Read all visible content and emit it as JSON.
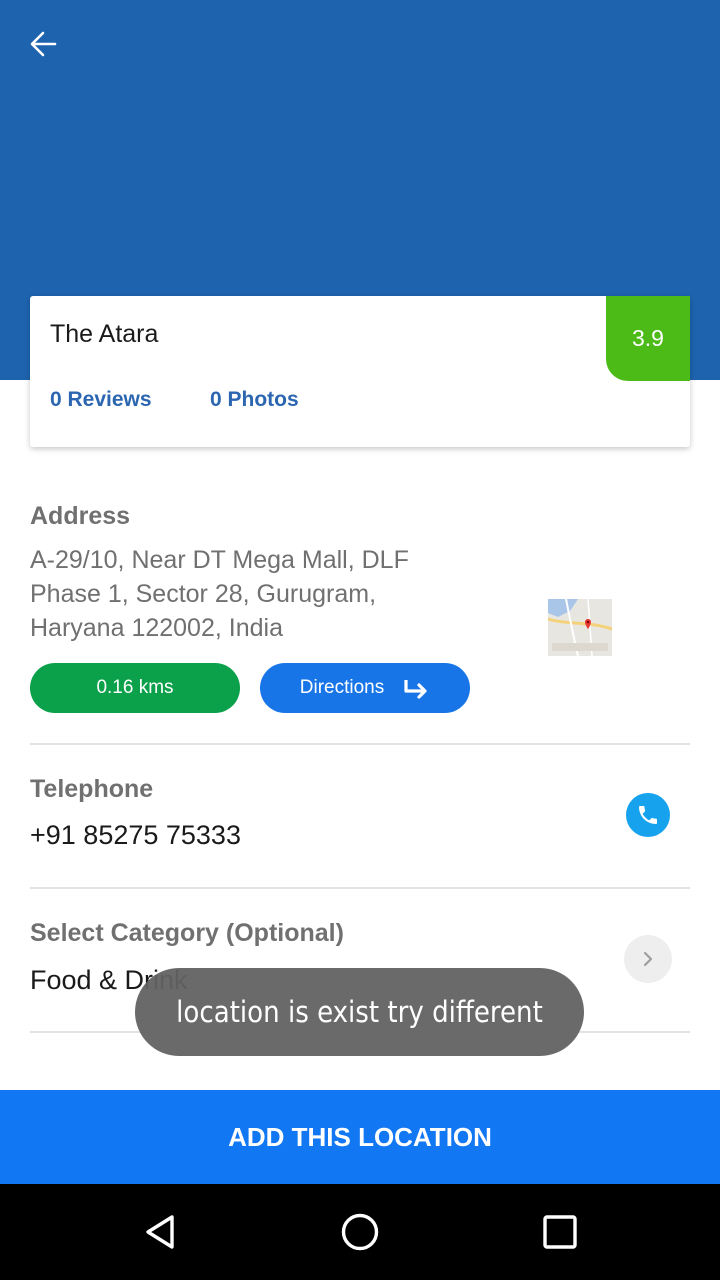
{
  "header": {
    "back_icon": "arrow-left-icon",
    "background_color": "#1e63ae"
  },
  "place": {
    "name": "The Atara",
    "rating": "3.9",
    "rating_color": "#4cbb17",
    "reviews_label": "0 Reviews",
    "photos_label": "0 Photos"
  },
  "address": {
    "label": "Address",
    "line1": "A-29/10, Near DT Mega Mall, DLF",
    "line2": "Phase 1, Sector 28, Gurugram,",
    "line3": "Haryana 122002, India",
    "map_icon": "map-thumbnail-icon",
    "distance": "0.16 kms",
    "directions_label": "Directions",
    "directions_icon": "turn-right-arrow-icon"
  },
  "telephone": {
    "label": "Telephone",
    "number": "+91 85275 75333",
    "call_icon": "phone-icon"
  },
  "category": {
    "label": "Select Category (Optional)",
    "value": "Food & Drink",
    "chevron_icon": "chevron-right-icon"
  },
  "toast": {
    "message": "location is exist try different"
  },
  "footer": {
    "add_label": "ADD THIS LOCATION",
    "button_color": "#1177f2"
  },
  "navbar": {
    "back_icon": "nav-back-triangle-icon",
    "home_icon": "nav-home-circle-icon",
    "recent_icon": "nav-recents-square-icon"
  }
}
